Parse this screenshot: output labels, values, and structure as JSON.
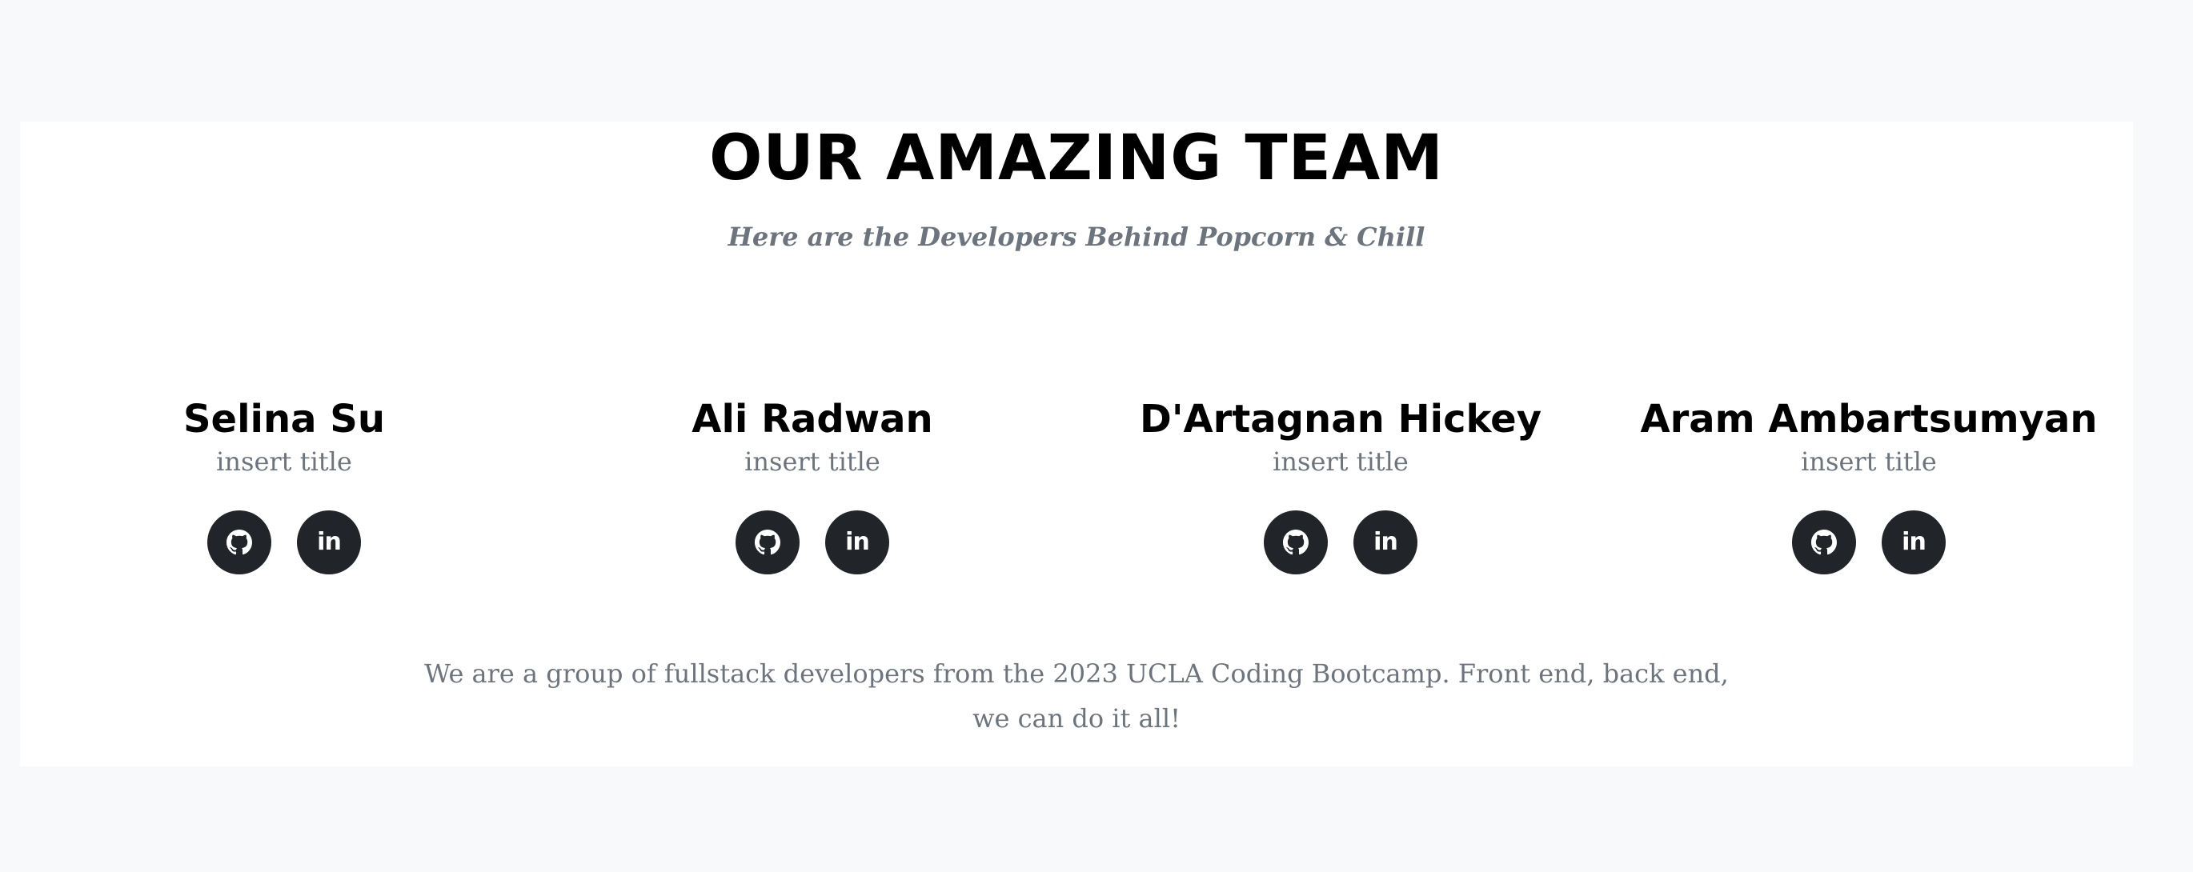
{
  "section": {
    "heading": "OUR AMAZING TEAM",
    "subheading": "Here are the Developers Behind Popcorn & Chill",
    "about": "We are a group of fullstack developers from the 2023 UCLA Coding Bootcamp. Front end, back end, we can do it all!"
  },
  "members": [
    {
      "name": "Selina Su",
      "title": "insert title"
    },
    {
      "name": "Ali Radwan",
      "title": "insert title"
    },
    {
      "name": "D'Artagnan Hickey",
      "title": "insert title"
    },
    {
      "name": "Aram Ambartsumyan",
      "title": "insert title"
    }
  ],
  "icons": {
    "github": "github-icon",
    "linkedin": "linkedin-icon",
    "linkedin_glyph": "in"
  },
  "colors": {
    "page_background": "#f8f9fa",
    "section_background": "#ffffff",
    "heading": "#000000",
    "muted_text": "#6c757d",
    "social_button": "#212529",
    "icon": "#ffffff"
  }
}
